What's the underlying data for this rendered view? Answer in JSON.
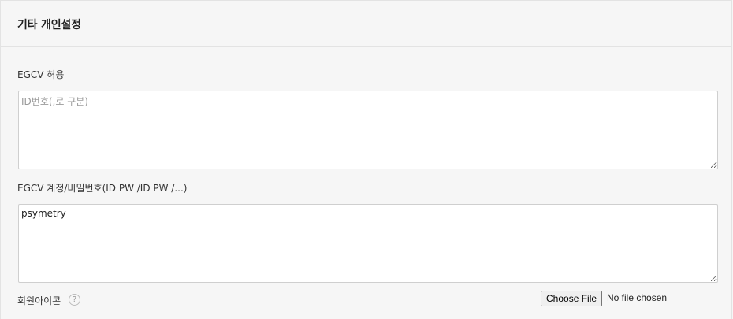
{
  "section": {
    "title": "기타 개인설정"
  },
  "egcv_allow": {
    "label": "EGCV 허용",
    "placeholder": "ID번호(,로 구분)",
    "value": ""
  },
  "egcv_accounts": {
    "label": "EGCV 계정/비밀번호(ID PW /ID PW /...)",
    "value": "psymetry"
  },
  "member_icon": {
    "label": "회원아이콘",
    "help_icon": "question-circle-icon",
    "help_glyph": "?",
    "file_button_label": "Choose File",
    "file_status": "No file chosen"
  }
}
